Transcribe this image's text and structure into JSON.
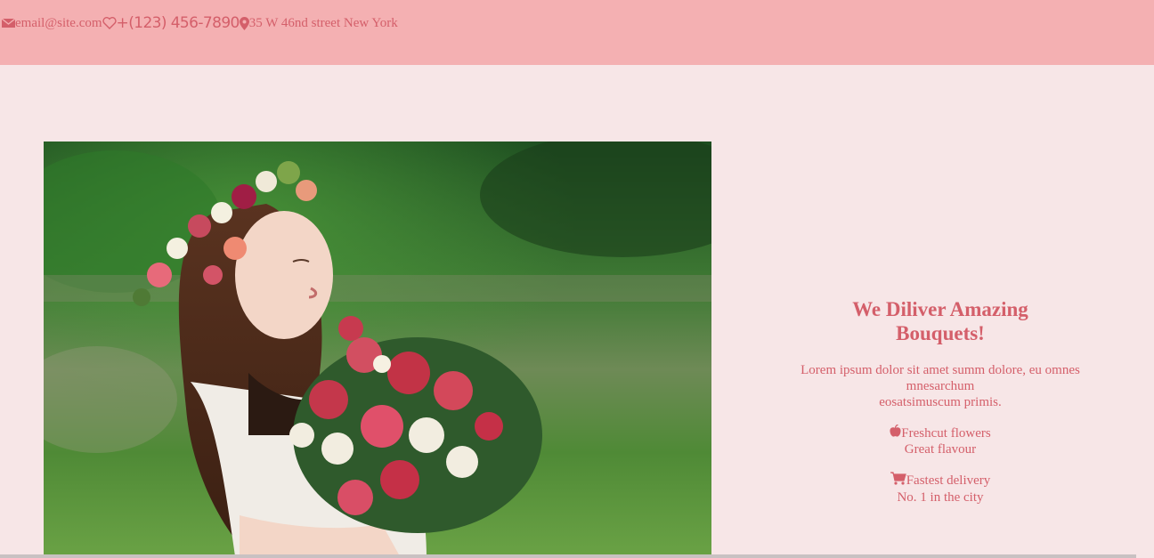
{
  "topbar": {
    "email": "email@site.com",
    "phone": "+(123) 456-7890",
    "address": "35 W 46nd street New York",
    "icons": [
      "envelope-icon",
      "heart-icon",
      "map-marker-icon"
    ]
  },
  "hero": {
    "image": "woman-with-flower-crown-photo"
  },
  "promo": {
    "title": "We Diliver Amazing Bouquets!",
    "description_line1": "Lorem ipsum dolor sit amet summ dolore, eu omnes mnesarchum",
    "description_line2": "eosatsimuscum primis.",
    "features": [
      {
        "icon": "apple-icon",
        "title": "Freshcut flowers",
        "subtitle": "Great flavour"
      },
      {
        "icon": "cart-icon",
        "title": "Fastest delivery",
        "subtitle": "No. 1 in the city"
      }
    ]
  },
  "colors": {
    "topbar_bg": "#f4b0b2",
    "page_bg": "#f7e6e7",
    "accent": "#d45f6a"
  }
}
